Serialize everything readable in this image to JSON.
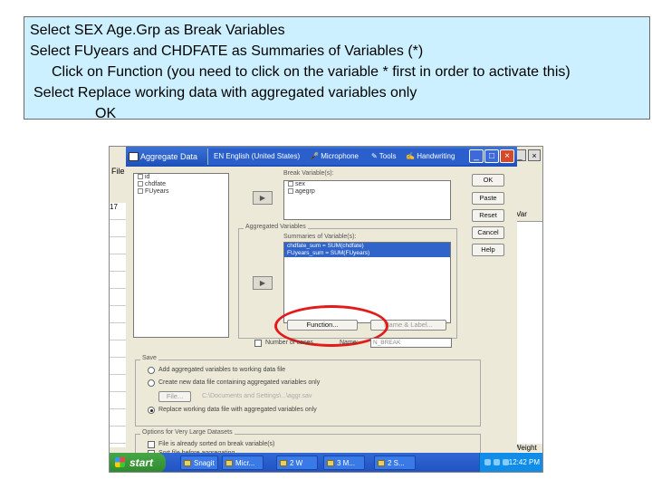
{
  "instructions": {
    "line1": "Select SEX Age.Grp as Break Variables",
    "line2": "Select FUyears and CHDFATE as Summaries of Variables (*)",
    "line3": "Click on Function (you need to click on the variable * first in order to activate this)",
    "line4": "Select Replace working data with aggregated variables only",
    "line5": "OK"
  },
  "background_app": {
    "menu_label": "File",
    "row_label": "17",
    "column_header": "Var",
    "weight_label": "Weight"
  },
  "dialog": {
    "title": "Aggregate Data",
    "language_bar": {
      "language": "EN English (United States)",
      "microphone": "Microphone",
      "tools": "Tools",
      "handwriting": "Handwriting"
    },
    "source_variables": [
      "id",
      "chdfate",
      "FUyears"
    ],
    "break_label": "Break Variable(s):",
    "break_variables": [
      "sex",
      "agegrp"
    ],
    "aggregated_group_label": "Aggregated Variables",
    "summaries_label": "Summaries of Variable(s):",
    "summaries": [
      "chdfate_sum = SUM(chdfate)",
      "FUyears_sum = SUM(FUyears)"
    ],
    "function_button": "Function...",
    "name_label_button": "Name & Label...",
    "number_of_cases_label": "Number of cases",
    "name_label": "Name:",
    "number_of_cases_name": "N_BREAK",
    "save_group_label": "Save",
    "save_options": {
      "add": "Add aggregated variables to working data file",
      "create": "Create new data file containing aggregated variables only",
      "file_button": "File...",
      "file_path": "C:\\Documents and Settings\\...\\aggr.sav",
      "replace": "Replace working data file with aggregated variables only"
    },
    "large_group_label": "Options for Very Large Datasets",
    "large_options": {
      "sorted": "File is already sorted on break variable(s)",
      "sort_before": "Sort file before aggregating"
    },
    "buttons": {
      "ok": "OK",
      "paste": "Paste",
      "reset": "Reset",
      "cancel": "Cancel",
      "help": "Help"
    }
  },
  "taskbar": {
    "start": "start",
    "tasks": [
      "Snagit",
      "Micr...",
      "2 W",
      "3 M...",
      "2 S..."
    ],
    "clock": "12:42 PM"
  },
  "colors": {
    "instruction_bg": "#ccf0ff",
    "highlight": "#e21b1b",
    "selection": "#3064c8",
    "titlebar": "#1d4fb8"
  }
}
